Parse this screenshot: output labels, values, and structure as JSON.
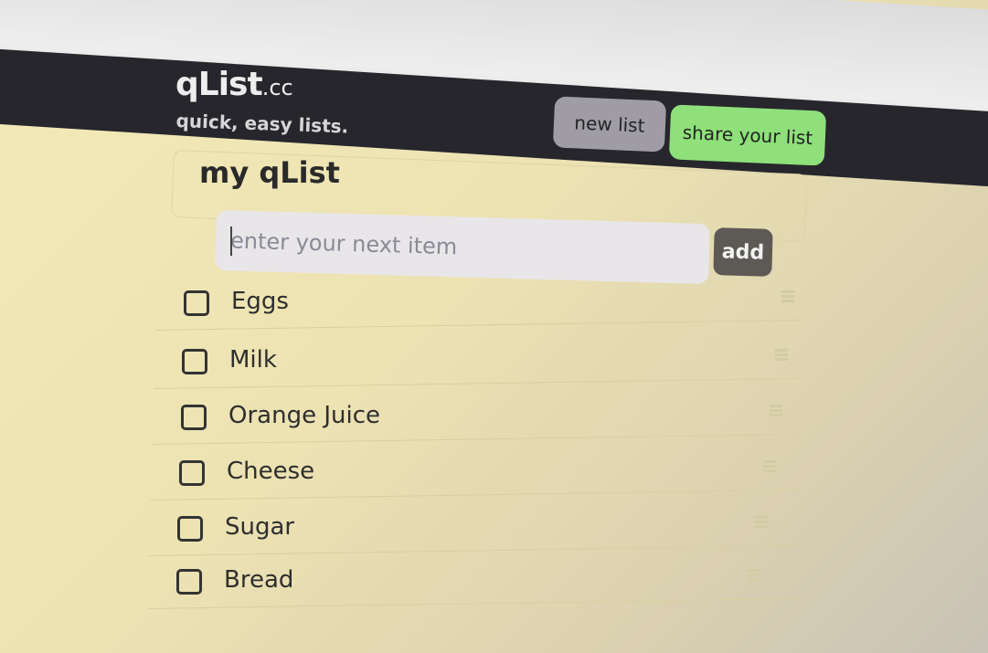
{
  "app": {
    "logo_main": "qList",
    "logo_tld": ".cc",
    "tagline": "quick, easy lists."
  },
  "header": {
    "new_list_label": "new list",
    "share_label": "share your list"
  },
  "list": {
    "title": "my qList",
    "input_placeholder": "enter your next item",
    "add_label": "add",
    "items": [
      {
        "label": "Eggs",
        "checked": false
      },
      {
        "label": "Milk",
        "checked": false
      },
      {
        "label": "Orange Juice",
        "checked": false
      },
      {
        "label": "Cheese",
        "checked": false
      },
      {
        "label": "Sugar",
        "checked": false
      },
      {
        "label": "Bread",
        "checked": false
      }
    ]
  },
  "colors": {
    "header_bg": "#26262c",
    "share_button": "#8fe07a",
    "new_list_button": "#9f9ca6",
    "add_button": "#5d5a56",
    "page_bg": "#f4eab8"
  }
}
